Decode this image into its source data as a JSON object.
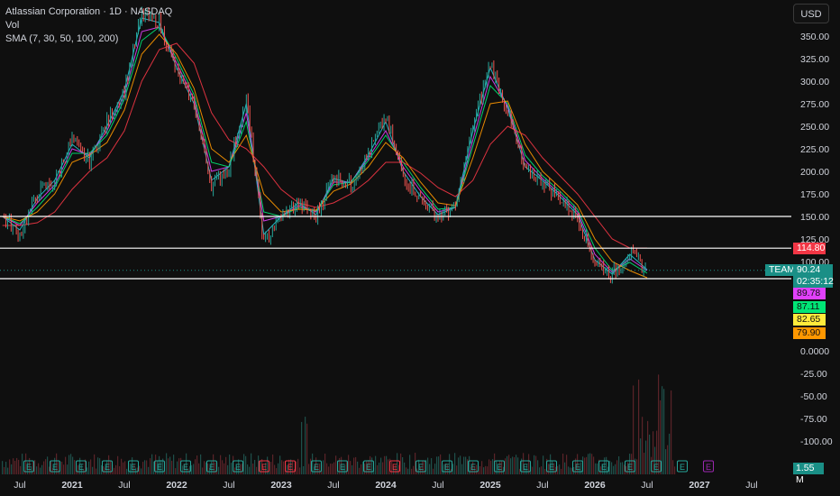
{
  "legend": {
    "title": "Atlassian Corporation · 1D · NASDAQ",
    "vol": "Vol",
    "sma": "SMA (7, 30, 50, 100, 200)"
  },
  "currency_label": "USD",
  "ticker_label": "TEAM",
  "last_price": "90.24",
  "countdown": "02:35:12",
  "volume_label": "1.55 M",
  "price_tags": [
    {
      "text": "114.80",
      "value": 114.8,
      "bg": "#f23645",
      "fg": "#ffffff"
    },
    {
      "text": "89.78",
      "value": 89.78,
      "bg": "#e040fb",
      "fg": "#111111"
    },
    {
      "text": "87.11",
      "value": 87.11,
      "bg": "#00e676",
      "fg": "#111111"
    },
    {
      "text": "82.65",
      "value": 82.65,
      "bg": "#ffeb3b",
      "fg": "#111111"
    },
    {
      "text": "79.90",
      "value": 79.9,
      "bg": "#ff9800",
      "fg": "#111111"
    }
  ],
  "chart_data": {
    "type": "line",
    "title": "Atlassian Corporation · 1D · NASDAQ",
    "price_axis_ticks": [
      "350.00",
      "325.00",
      "300.00",
      "275.00",
      "250.00",
      "225.00",
      "200.00",
      "175.00",
      "150.00",
      "125.00",
      "100.00"
    ],
    "volume_axis_ticks": [
      "0.0000",
      "-25.00",
      "-50.00",
      "-75.00",
      "-100.00"
    ],
    "x_tick_labels": [
      "Jul",
      "2021",
      "Jul",
      "2022",
      "Jul",
      "2023",
      "Jul",
      "2024",
      "Jul",
      "2025",
      "Jul",
      "2026",
      "Jul",
      "2027",
      "Jul"
    ],
    "ylim": [
      75,
      380
    ],
    "horizontal_lines": [
      150,
      114.8,
      81
    ],
    "dotted_line": 90.24,
    "price_series": {
      "name": "TEAM",
      "x": [
        "2020-05",
        "2020-07",
        "2020-09",
        "2020-11",
        "2021-01",
        "2021-03",
        "2021-05",
        "2021-07",
        "2021-09",
        "2021-11",
        "2022-01",
        "2022-03",
        "2022-05",
        "2022-07",
        "2022-09",
        "2022-11",
        "2023-01",
        "2023-03",
        "2023-05",
        "2023-07",
        "2023-09",
        "2023-11",
        "2024-01",
        "2024-03",
        "2024-05",
        "2024-07",
        "2024-09",
        "2024-11",
        "2025-01",
        "2025-03",
        "2025-05",
        "2025-07",
        "2025-09",
        "2025-11",
        "2026-01",
        "2026-03",
        "2026-05",
        "2026-07"
      ],
      "y": [
        150,
        130,
        175,
        190,
        235,
        210,
        255,
        290,
        375,
        365,
        310,
        275,
        185,
        205,
        280,
        120,
        150,
        165,
        150,
        195,
        185,
        220,
        260,
        195,
        170,
        150,
        160,
        250,
        320,
        265,
        200,
        190,
        170,
        150,
        100,
        85,
        110,
        90
      ]
    },
    "sma_series": [
      {
        "name": "SMA 7",
        "color": "#26c6da",
        "y": [
          150,
          135,
          170,
          190,
          230,
          215,
          250,
          290,
          370,
          365,
          315,
          275,
          190,
          205,
          275,
          130,
          150,
          165,
          152,
          192,
          187,
          218,
          255,
          200,
          172,
          152,
          160,
          245,
          315,
          270,
          205,
          190,
          172,
          152,
          102,
          86,
          108,
          91
        ]
      },
      {
        "name": "SMA 30",
        "color": "#e040fb",
        "y": [
          150,
          140,
          165,
          185,
          225,
          218,
          245,
          285,
          355,
          360,
          320,
          280,
          200,
          205,
          265,
          145,
          150,
          162,
          155,
          188,
          188,
          215,
          245,
          205,
          178,
          155,
          160,
          235,
          305,
          272,
          212,
          192,
          175,
          155,
          108,
          88,
          103,
          90
        ]
      },
      {
        "name": "SMA 50",
        "color": "#00e676",
        "y": [
          150,
          142,
          160,
          182,
          220,
          220,
          240,
          280,
          345,
          360,
          325,
          285,
          210,
          205,
          255,
          155,
          150,
          160,
          156,
          185,
          188,
          212,
          240,
          210,
          182,
          158,
          160,
          228,
          295,
          275,
          218,
          195,
          178,
          158,
          115,
          90,
          99,
          87
        ]
      },
      {
        "name": "SMA 100",
        "color": "#ff9800",
        "y": [
          150,
          145,
          155,
          175,
          210,
          218,
          232,
          268,
          330,
          352,
          330,
          292,
          225,
          210,
          240,
          175,
          155,
          158,
          157,
          178,
          186,
          205,
          232,
          215,
          188,
          165,
          162,
          215,
          275,
          278,
          230,
          200,
          182,
          163,
          125,
          100,
          90,
          82
        ]
      },
      {
        "name": "SMA 200",
        "color": "#f23645",
        "y": [
          140,
          140,
          143,
          155,
          180,
          200,
          215,
          245,
          300,
          335,
          342,
          320,
          265,
          235,
          225,
          205,
          180,
          165,
          160,
          165,
          175,
          190,
          210,
          210,
          198,
          182,
          172,
          190,
          230,
          250,
          240,
          215,
          195,
          175,
          150,
          125,
          115,
          115
        ]
      }
    ],
    "volume_markers": [
      {
        "label": "E",
        "color": "#26a69a"
      },
      {
        "label": "E",
        "color": "#26a69a"
      },
      {
        "label": "E",
        "color": "#26a69a"
      },
      {
        "label": "E",
        "color": "#26a69a"
      },
      {
        "label": "E",
        "color": "#26a69a"
      },
      {
        "label": "E",
        "color": "#26a69a"
      },
      {
        "label": "E",
        "color": "#26a69a"
      },
      {
        "label": "E",
        "color": "#26a69a"
      },
      {
        "label": "E",
        "color": "#26a69a"
      },
      {
        "label": "E",
        "color": "#f23645"
      },
      {
        "label": "E",
        "color": "#f23645"
      },
      {
        "label": "E",
        "color": "#26a69a"
      },
      {
        "label": "E",
        "color": "#26a69a"
      },
      {
        "label": "E",
        "color": "#26a69a"
      },
      {
        "label": "E",
        "color": "#f23645"
      },
      {
        "label": "E",
        "color": "#26a69a"
      },
      {
        "label": "E",
        "color": "#26a69a"
      },
      {
        "label": "E",
        "color": "#26a69a"
      },
      {
        "label": "E",
        "color": "#26a69a"
      },
      {
        "label": "E",
        "color": "#26a69a"
      },
      {
        "label": "E",
        "color": "#26a69a"
      },
      {
        "label": "E",
        "color": "#26a69a"
      },
      {
        "label": "E",
        "color": "#26a69a"
      },
      {
        "label": "E",
        "color": "#26a69a"
      },
      {
        "label": "E",
        "color": "#26a69a"
      },
      {
        "label": "E",
        "color": "#26a69a"
      },
      {
        "label": "E",
        "color": "#9c27b0"
      }
    ],
    "grid": true,
    "legend_position": "top-left"
  }
}
